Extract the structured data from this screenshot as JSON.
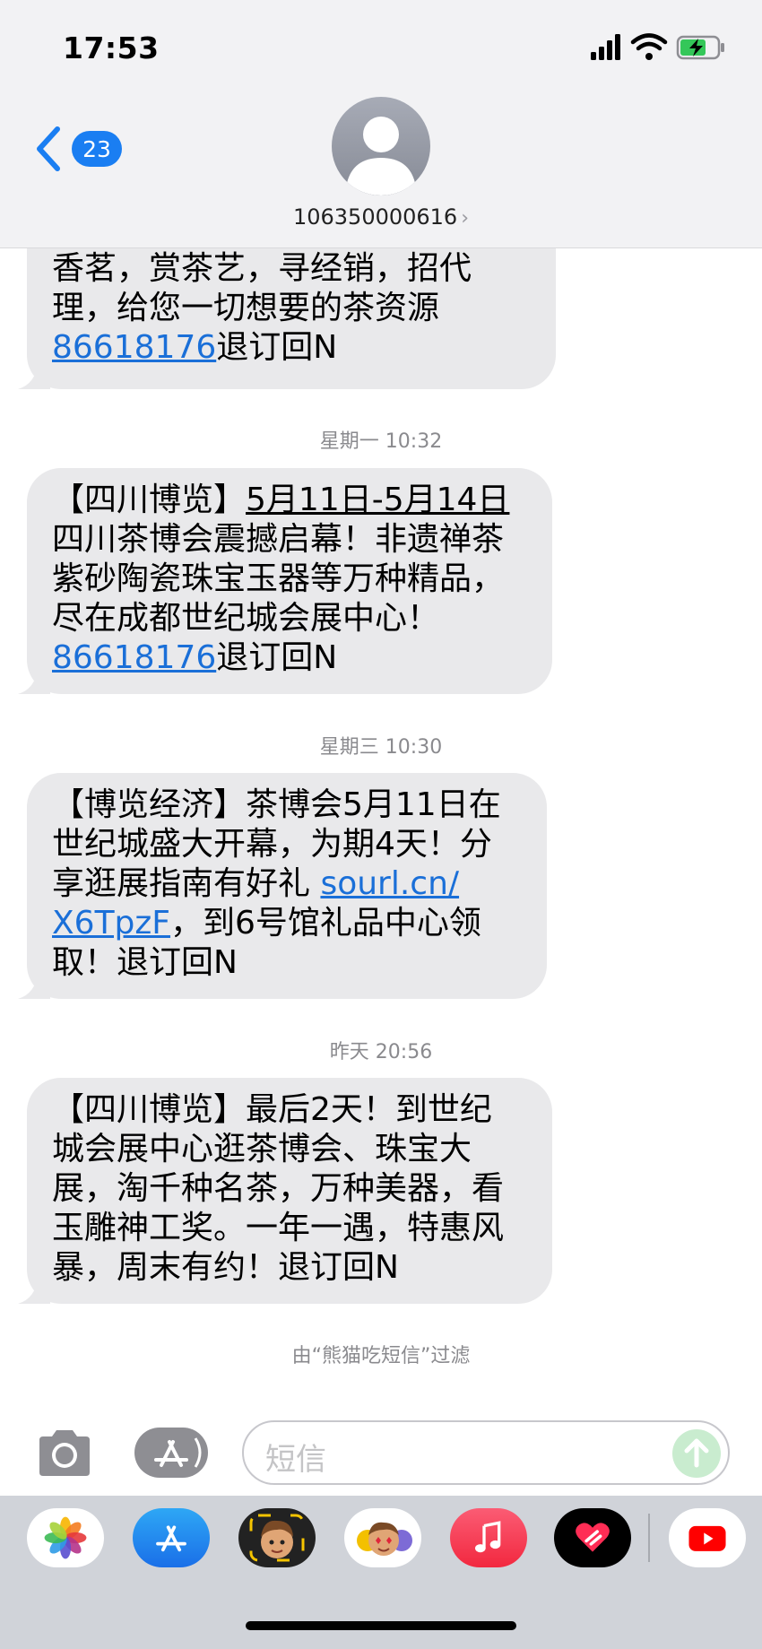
{
  "status_bar": {
    "time": "17:53"
  },
  "header": {
    "back_count": "23",
    "sender": "106350000616"
  },
  "messages": [
    {
      "lines": [
        "香茗，赏茶艺，寻经销，招代",
        "理，给您一切想要的茶资源"
      ],
      "link": "86618176",
      "tail": "退订回N"
    },
    {
      "timestamp": "星期一 10:32",
      "prefix": "【四川博览】",
      "date_range": "5月11日-5月14日",
      "lines": [
        "四川茶博会震撼启幕！非遗禅茶",
        "紫砂陶瓷珠宝玉器等万种精品，",
        "尽在成都世纪城会展中心！"
      ],
      "link": "86618176",
      "tail": "退订回N"
    },
    {
      "timestamp": "星期三 10:30",
      "line1": "【博览经济】茶博会5月11日在",
      "line2": "世纪城盛大开幕，为期4天！分",
      "line3_text": "享逛展指南有好礼 ",
      "link_a": "sourl.cn/",
      "link_b": "X6TpzF",
      "line4_rest": "，到6号馆礼品中心领",
      "line5": "取！退订回N"
    },
    {
      "timestamp": "昨天 20:56",
      "lines": [
        "【四川博览】最后2天！到世纪",
        "城会展中心逛茶博会、珠宝大",
        "展，淘千种名茶，万种美器，看",
        "玉雕神工奖。一年一遇，特惠风",
        "暴，周末有约！退订回N"
      ]
    }
  ],
  "filter_note": "由“熊猫吃短信”过滤",
  "compose": {
    "placeholder": "短信"
  },
  "app_drawer": [
    "photos-icon",
    "app-store-icon",
    "memoji-icon",
    "animoji-stickers-icon",
    "music-icon",
    "digital-touch-icon",
    "youtube-icon"
  ],
  "colors": {
    "link": "#1a6fd8",
    "badge": "#1a7ef2",
    "bubble": "#e9e9eb",
    "send": "#c9eccf"
  }
}
